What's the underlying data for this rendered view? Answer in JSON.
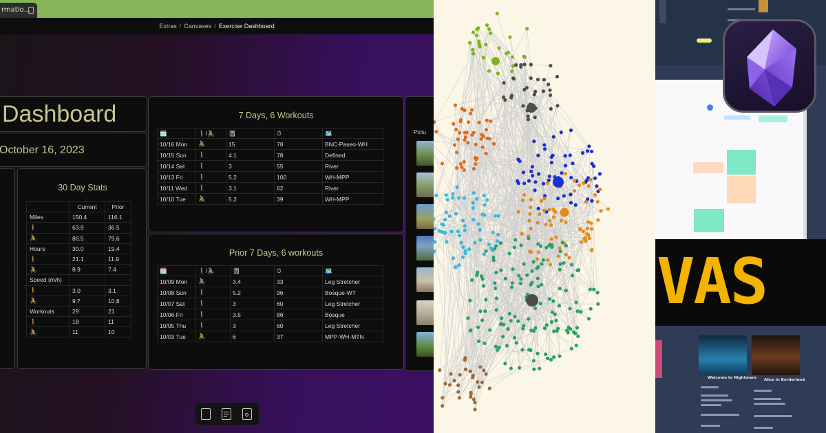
{
  "tab": {
    "label": "rmatio..."
  },
  "breadcrumb": {
    "part1": "Extras",
    "part2": "Canvases",
    "current": "Exercise Dashboard",
    "sep": "/"
  },
  "dashboard": {
    "title": "Dashboard",
    "date": "October 16, 2023"
  },
  "stats": {
    "heading": "30 Day Stats",
    "columns": [
      "",
      "Current",
      "Prior"
    ],
    "rows": [
      [
        "Miles",
        "150.4",
        "116.1"
      ],
      [
        "🚶",
        "63.9",
        "36.5"
      ],
      [
        "🚴",
        "86.5",
        "79.6"
      ],
      [
        "Hours",
        "30.0",
        "19.4"
      ],
      [
        "🚶",
        "21.1",
        "11.9"
      ],
      [
        "🚴",
        "8.9",
        "7.4"
      ],
      [
        "Speed (m/h)",
        "",
        ""
      ],
      [
        "🚶",
        "3.0",
        "3.1"
      ],
      [
        "🚴",
        "9.7",
        "10.8"
      ],
      [
        "Workouts",
        "29",
        "21"
      ],
      [
        "🚶",
        "18",
        "11"
      ],
      [
        "🚴",
        "11",
        "10"
      ]
    ]
  },
  "week": {
    "heading": "7 Days, 6 Workouts",
    "columns": [
      "🗓️",
      "🚶/🚴",
      "📓",
      "⏱",
      "🗺️"
    ],
    "rows": [
      [
        "10/16 Mon",
        "🚴",
        "15",
        "78",
        "BNC-Paseo-WH"
      ],
      [
        "10/15 Sun",
        "🚶",
        "4.1",
        "78",
        "Defined"
      ],
      [
        "10/14 Sat",
        "🚶",
        "3",
        "55",
        "River"
      ],
      [
        "10/13 Fri",
        "🚶",
        "5.2",
        "100",
        "WH-MPP"
      ],
      [
        "10/11 Wed",
        "🚶",
        "3.1",
        "62",
        "River"
      ],
      [
        "10/10 Tue",
        "🚴",
        "5.2",
        "39",
        "WH-MPP"
      ]
    ]
  },
  "prior": {
    "heading": "Prior 7 Days, 6 workouts",
    "columns": [
      "🗓️",
      "🚶/🚴",
      "📓",
      "⏱",
      "🗺️"
    ],
    "rows": [
      [
        "10/09 Mon",
        "🚴",
        "3.4",
        "33",
        "Leg Stretcher"
      ],
      [
        "10/08 Sun",
        "🚶",
        "5.2",
        "96",
        "Bosque-WT"
      ],
      [
        "10/07 Sat",
        "🚶",
        "3",
        "60",
        "Leg Stretcher"
      ],
      [
        "10/06 Fri",
        "🚶",
        "3.5",
        "86",
        "Bosque"
      ],
      [
        "10/05 Thu",
        "🚶",
        "3",
        "60",
        "Leg Stretcher"
      ],
      [
        "10/03 Tue",
        "🚴",
        "6",
        "37",
        "MPP-WH-MTN"
      ]
    ]
  },
  "pictures": {
    "label": "Pictu"
  },
  "right_panel": {
    "banner_text": "VAS",
    "posters": [
      {
        "title": "Welcome to Nightmare"
      },
      {
        "title": "Alice in Borderland"
      }
    ]
  },
  "colors": {
    "tabbar": "#86b458",
    "gold_text": "#c8c58b",
    "graph_bg": "#fbf6e6",
    "banner_yellow": "#f4b300"
  }
}
